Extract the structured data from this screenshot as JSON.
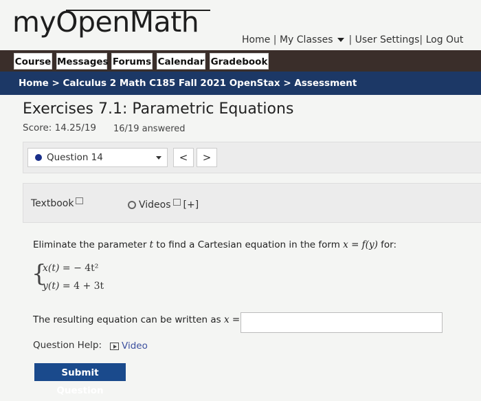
{
  "header": {
    "logo_text": "myOpenMath",
    "nav": {
      "home": "Home",
      "my_classes": "My Classes",
      "user_settings": "User Settings",
      "log_out": "Log Out",
      "separator": "|"
    }
  },
  "tabs": [
    "Course",
    "Messages",
    "Forums",
    "Calendar",
    "Gradebook"
  ],
  "breadcrumb": {
    "home": "Home",
    "course": "Calculus 2 Math C185 Fall 2021 OpenStax",
    "page": "Assessment",
    "separator": ">"
  },
  "assessment": {
    "title": "Exercises 7.1: Parametric Equations",
    "score": "Score: 14.25/19",
    "answered": "16/19 answered"
  },
  "question_nav": {
    "selected": "Question 14",
    "prev": "<",
    "next": ">"
  },
  "help_links": {
    "textbook": "Textbook",
    "videos": "Videos",
    "expand": "[+]"
  },
  "question": {
    "prompt_before": "Eliminate the parameter",
    "param": "t",
    "prompt_middle": "to find a Cartesian equation in the form",
    "form": "x = f(y)",
    "prompt_after": "for:",
    "eq1_lhs": "x(t)",
    "eq1_rhs": "=   − 4t²",
    "eq2_lhs": "y(t)",
    "eq2_rhs": "= 4 + 3t",
    "result_label": "The resulting equation can be written as",
    "result_var": "x =",
    "answer_value": ""
  },
  "question_help": {
    "label": "Question Help:",
    "video": "Video"
  },
  "submit_label": "Submit Question"
}
